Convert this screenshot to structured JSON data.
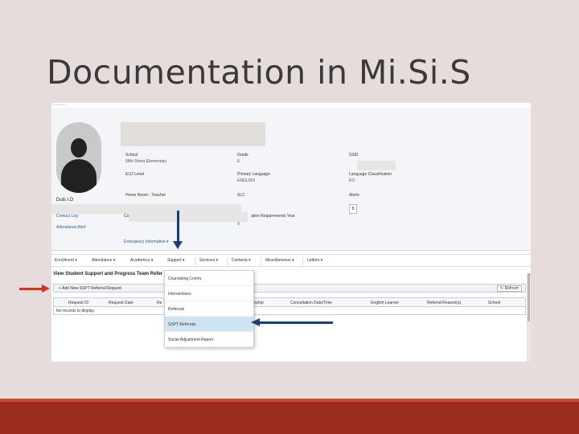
{
  "slide": {
    "title": "Documentation in Mi.Si.S"
  },
  "colors": {
    "background": "#e5dcdb",
    "footer": "#9b2d1f",
    "arrow_blue": "#1b3f73",
    "arrow_red": "#c0392b",
    "link": "#1f5fa8",
    "selected_row": "#cfe4f3"
  },
  "profile": {
    "photo_icon": "person-silhouette-icon",
    "name_fragment": "Duls I.D",
    "links": [
      "Contact Log",
      "Attendance Alert"
    ],
    "emergency_label": "Emergency Information",
    "fields": {
      "school_label": "School",
      "school_value": "68th Street Elementary",
      "grade_label": "Grade",
      "grade_value": "6",
      "ssid_label": "SSID",
      "eld_label": "ELD Level",
      "primary_language_label": "Primary Language",
      "primary_language_value": "ENGLISH",
      "language_class_label": "Language Classification",
      "language_class_value": "EO",
      "homeroom_label": "Home Room - Teacher",
      "slc_label": "SLC",
      "alerts_label": "Alerts",
      "alerts_value": "8",
      "graduation_prefix": "Co",
      "graduation_label": "ation Requirements Year",
      "graduation_value": "0"
    }
  },
  "menu": {
    "items": [
      "Enrollment",
      "Attendance",
      "Academics",
      "Support",
      "Services",
      "Contacts",
      "Miscellaneous",
      "Letters"
    ]
  },
  "section": {
    "title": "View Student Support and Progress Team Refer",
    "add_button": "Add New SSPT Referral Request",
    "refresh_button": "Refresh",
    "columns": [
      "Request ID",
      "Request Date",
      "Re",
      "onship",
      "Consultation Date/Time",
      "English Learner",
      "Referral Reason(s)",
      "School"
    ],
    "empty_message": "No records to display."
  },
  "dropdown": {
    "items": [
      "Counseling Comm.",
      "Interventions",
      "Referrals",
      "SSPT Referrals",
      "Social Adjustment Report"
    ],
    "selected": "SSPT Referrals"
  }
}
